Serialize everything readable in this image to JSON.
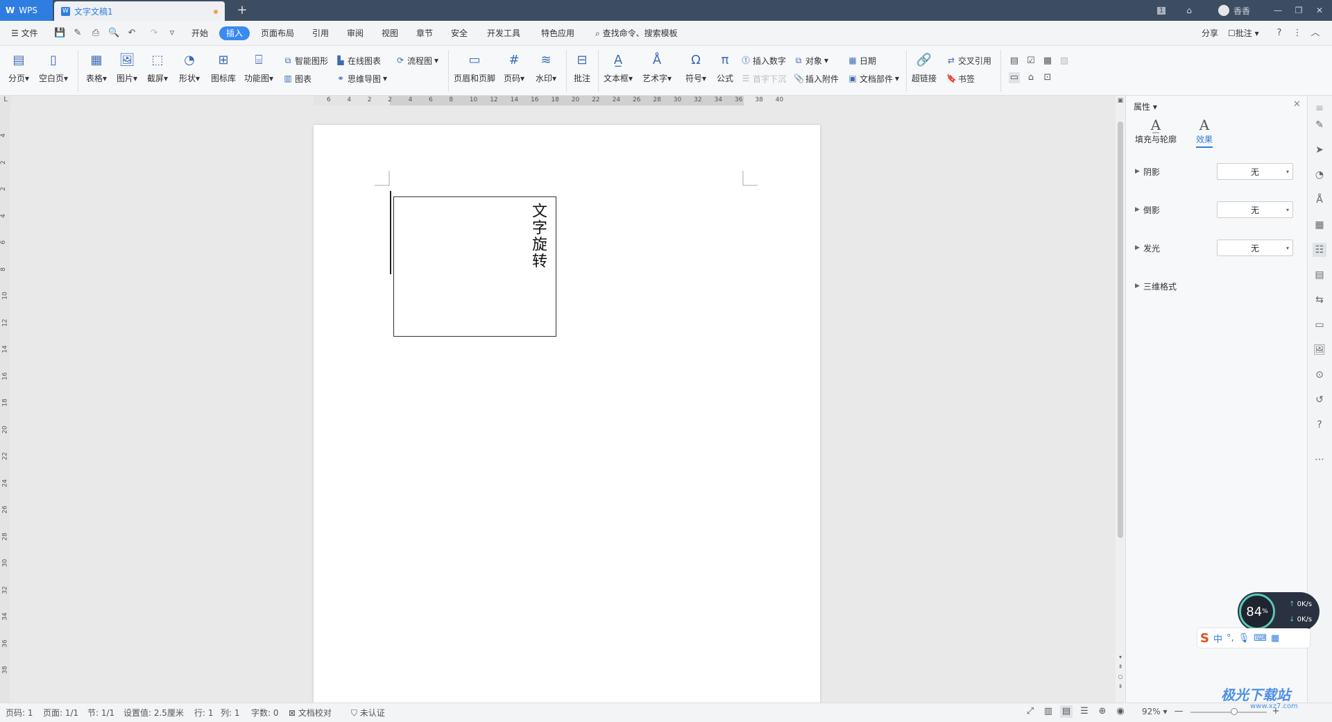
{
  "titlebar": {
    "app_name": "WPS",
    "doc_tab": "文字文稿1",
    "new_tab": "+",
    "page_indicator": "1",
    "user_name": "香香"
  },
  "menu": {
    "file": "文件",
    "items": [
      "开始",
      "插入",
      "页面布局",
      "引用",
      "审阅",
      "视图",
      "章节",
      "安全",
      "开发工具",
      "特色应用"
    ],
    "active": "插入",
    "search": "查找命令、搜索模板",
    "share": "分享",
    "comment": "批注"
  },
  "ribbon": {
    "big": [
      {
        "label": "分页",
        "icon": "page-break-icon"
      },
      {
        "label": "空白页",
        "icon": "blank-page-icon"
      },
      {
        "label": "表格",
        "icon": "table-icon"
      },
      {
        "label": "图片",
        "icon": "image-icon"
      },
      {
        "label": "截屏",
        "icon": "screenshot-icon"
      },
      {
        "label": "形状",
        "icon": "shapes-icon"
      },
      {
        "label": "图标库",
        "icon": "icon-library-icon"
      },
      {
        "label": "功能图",
        "icon": "function-chart-icon"
      },
      {
        "label": "页眉和页脚",
        "icon": "header-footer-icon"
      },
      {
        "label": "页码",
        "icon": "page-number-icon"
      },
      {
        "label": "水印",
        "icon": "watermark-icon"
      },
      {
        "label": "批注",
        "icon": "comment-icon"
      },
      {
        "label": "文本框",
        "icon": "textbox-icon"
      },
      {
        "label": "艺术字",
        "icon": "wordart-icon"
      },
      {
        "label": "符号",
        "icon": "symbol-icon"
      },
      {
        "label": "公式",
        "icon": "formula-icon"
      },
      {
        "label": "超链接",
        "icon": "hyperlink-icon"
      }
    ],
    "small": {
      "smart_shape": "智能图形",
      "online_chart": "在线图表",
      "flowchart": "流程图",
      "chart": "图表",
      "mindmap": "思维导图",
      "insert_number": "插入数字",
      "object": "对象",
      "date": "日期",
      "drop_cap": "首字下沉",
      "attachment": "插入附件",
      "doc_parts": "文档部件",
      "cross_ref": "交叉引用",
      "bookmark": "书签"
    }
  },
  "ruler": {
    "h_ticks": [
      "6",
      "4",
      "2",
      "2",
      "4",
      "6",
      "8",
      "10",
      "12",
      "14",
      "16",
      "18",
      "20",
      "22",
      "24",
      "26",
      "28",
      "30",
      "32",
      "34",
      "36",
      "38",
      "40"
    ],
    "v_ticks": [
      "4",
      "2",
      "2",
      "4",
      "6",
      "8",
      "10",
      "12",
      "14",
      "16",
      "18",
      "20",
      "22",
      "24",
      "26",
      "28",
      "30",
      "32",
      "34",
      "36",
      "38"
    ]
  },
  "document": {
    "textbox_text": "文字旋转"
  },
  "panel": {
    "title": "属性",
    "tabs": [
      "填充与轮廓",
      "效果"
    ],
    "active_tab": "效果",
    "rows": [
      {
        "label": "阴影",
        "value": "无"
      },
      {
        "label": "倒影",
        "value": "无"
      },
      {
        "label": "发光",
        "value": "无"
      },
      {
        "label": "三维格式",
        "value": ""
      }
    ]
  },
  "status": {
    "page": "页码: 1",
    "pages": "页面: 1/1",
    "section": "节: 1/1",
    "setting": "设置值: 2.5厘米",
    "row": "行: 1",
    "col": "列: 1",
    "words": "字数: 0",
    "proofing": "文档校对",
    "auth": "未认证",
    "zoom": "92%"
  },
  "widgets": {
    "speed_percent": "84",
    "speed_unit": "%",
    "up": "0K/s",
    "down": "0K/s",
    "ime_mode": "中",
    "watermark": "极光下载站",
    "watermark_url": "www.xz7.com"
  }
}
